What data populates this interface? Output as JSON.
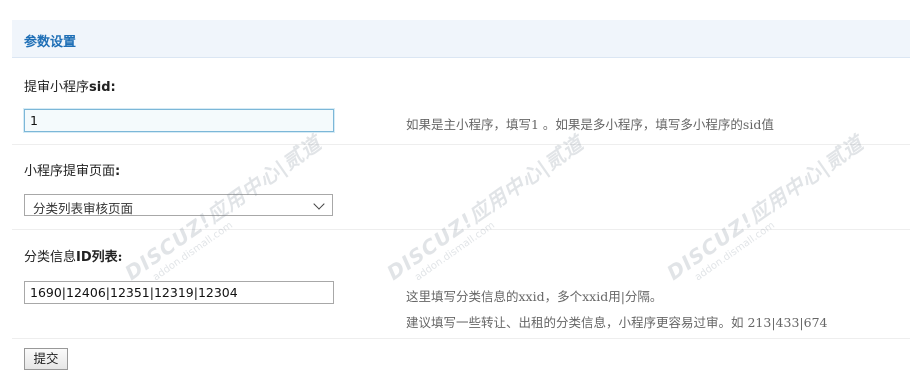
{
  "header": {
    "title": "参数设置"
  },
  "rows": [
    {
      "label_prefix": "提审小程序",
      "label_bold": "sid",
      "label_suffix": ":",
      "value": "1",
      "hint_line1": "如果是主小程序，填写1 。如果是多小程序，填写多小程序的sid值"
    },
    {
      "label_prefix": "小程序提审页面",
      "label_bold": "",
      "label_suffix": ":",
      "selected_option": "分类列表审核页面",
      "hint_line1": ""
    },
    {
      "label_prefix": "分类信息",
      "label_bold": "ID",
      "label_suffix": "列表:",
      "value": "1690|12406|12351|12319|12304",
      "hint_line1": "这里填写分类信息的xxid，多个xxid用|分隔。",
      "hint_line2": "建议填写一些转让、出租的分类信息，小程序更容易过审。如 213|433|674"
    }
  ],
  "submit_label": "提交",
  "watermark": {
    "brand": "DISCUZ!应用中心|贰道",
    "site": "addon.dismall.com"
  }
}
